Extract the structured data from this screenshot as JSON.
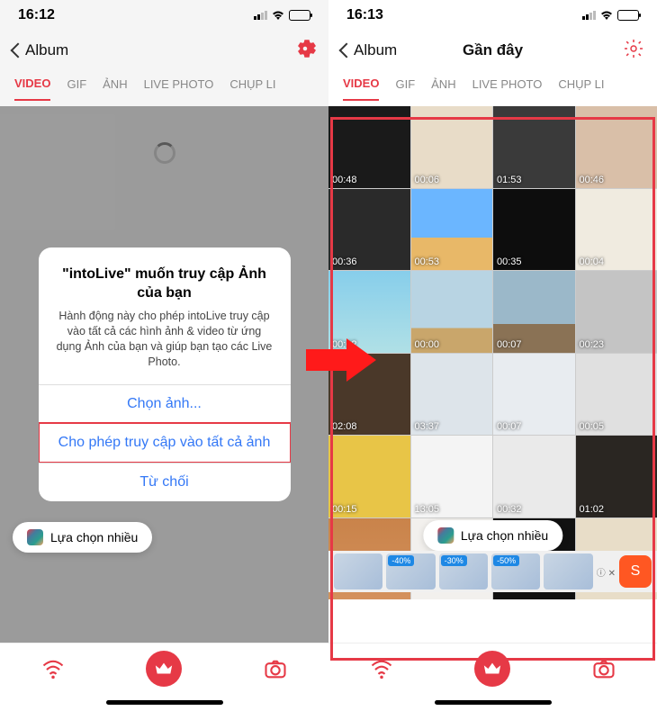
{
  "left": {
    "time": "16:12",
    "back": "Album",
    "tabs": [
      "VIDEO",
      "GIF",
      "ẢNH",
      "LIVE PHOTO",
      "CHỤP LI"
    ],
    "alert": {
      "title": "\"intoLive\" muốn truy cập Ảnh của bạn",
      "message": "Hành động này cho phép intoLive truy cập vào tất cả các hình ảnh & video từ ứng dụng Ảnh của bạn và giúp bạn tạo các Live Photo.",
      "btn_select": "Chọn ảnh...",
      "btn_allow": "Cho phép truy cập vào tất cả ảnh",
      "btn_deny": "Từ chối"
    },
    "multiselect": "Lựa chọn nhiều"
  },
  "right": {
    "time": "16:13",
    "back": "Album",
    "title": "Gần đây",
    "tabs": [
      "VIDEO",
      "GIF",
      "ẢNH",
      "LIVE PHOTO",
      "CHỤP LI"
    ],
    "durations": [
      "00:48",
      "00:06",
      "01:53",
      "00:46",
      "00:36",
      "00:53",
      "00:35",
      "00:04",
      "00:02",
      "00:00",
      "00:07",
      "00:23",
      "02:08",
      "03:37",
      "00:07",
      "00:05",
      "00:15",
      "13:05",
      "00:32",
      "01:02",
      "",
      "",
      "",
      ""
    ],
    "multiselect": "Lựa chọn nhiều",
    "ad_badges": [
      "",
      "-40%",
      "-30%",
      "-50%"
    ],
    "ad_info": "ⓘ ✕"
  }
}
